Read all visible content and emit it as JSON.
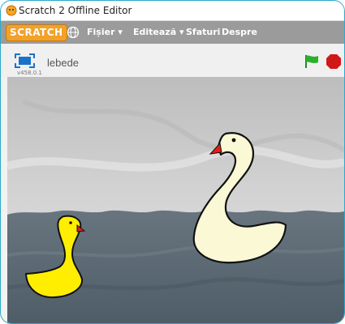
{
  "window": {
    "title": "Scratch 2 Offline Editor"
  },
  "menu": {
    "logo": "SCRATCH",
    "items": [
      "Fișier ▾",
      "Editează ▾",
      "Sfaturi",
      "Despre"
    ]
  },
  "stage_header": {
    "project_name": "lebede",
    "version": "v458.0.1"
  },
  "colors": {
    "menu_bg": "#9b9b9b",
    "logo": "#f2a12a",
    "flag": "#2bb02b",
    "stop": "#d01818",
    "water": "#5f6f7b",
    "wall": "#c9c9c9",
    "yellow_duck": "#ffee00",
    "white_swan": "#fbf8d6",
    "beak": "#e0201a"
  },
  "icons": [
    "scratch-cat-icon",
    "globe-icon",
    "fullscreen-icon",
    "green-flag-icon",
    "stop-icon"
  ],
  "sprites": [
    "white-swan",
    "yellow-duck"
  ]
}
